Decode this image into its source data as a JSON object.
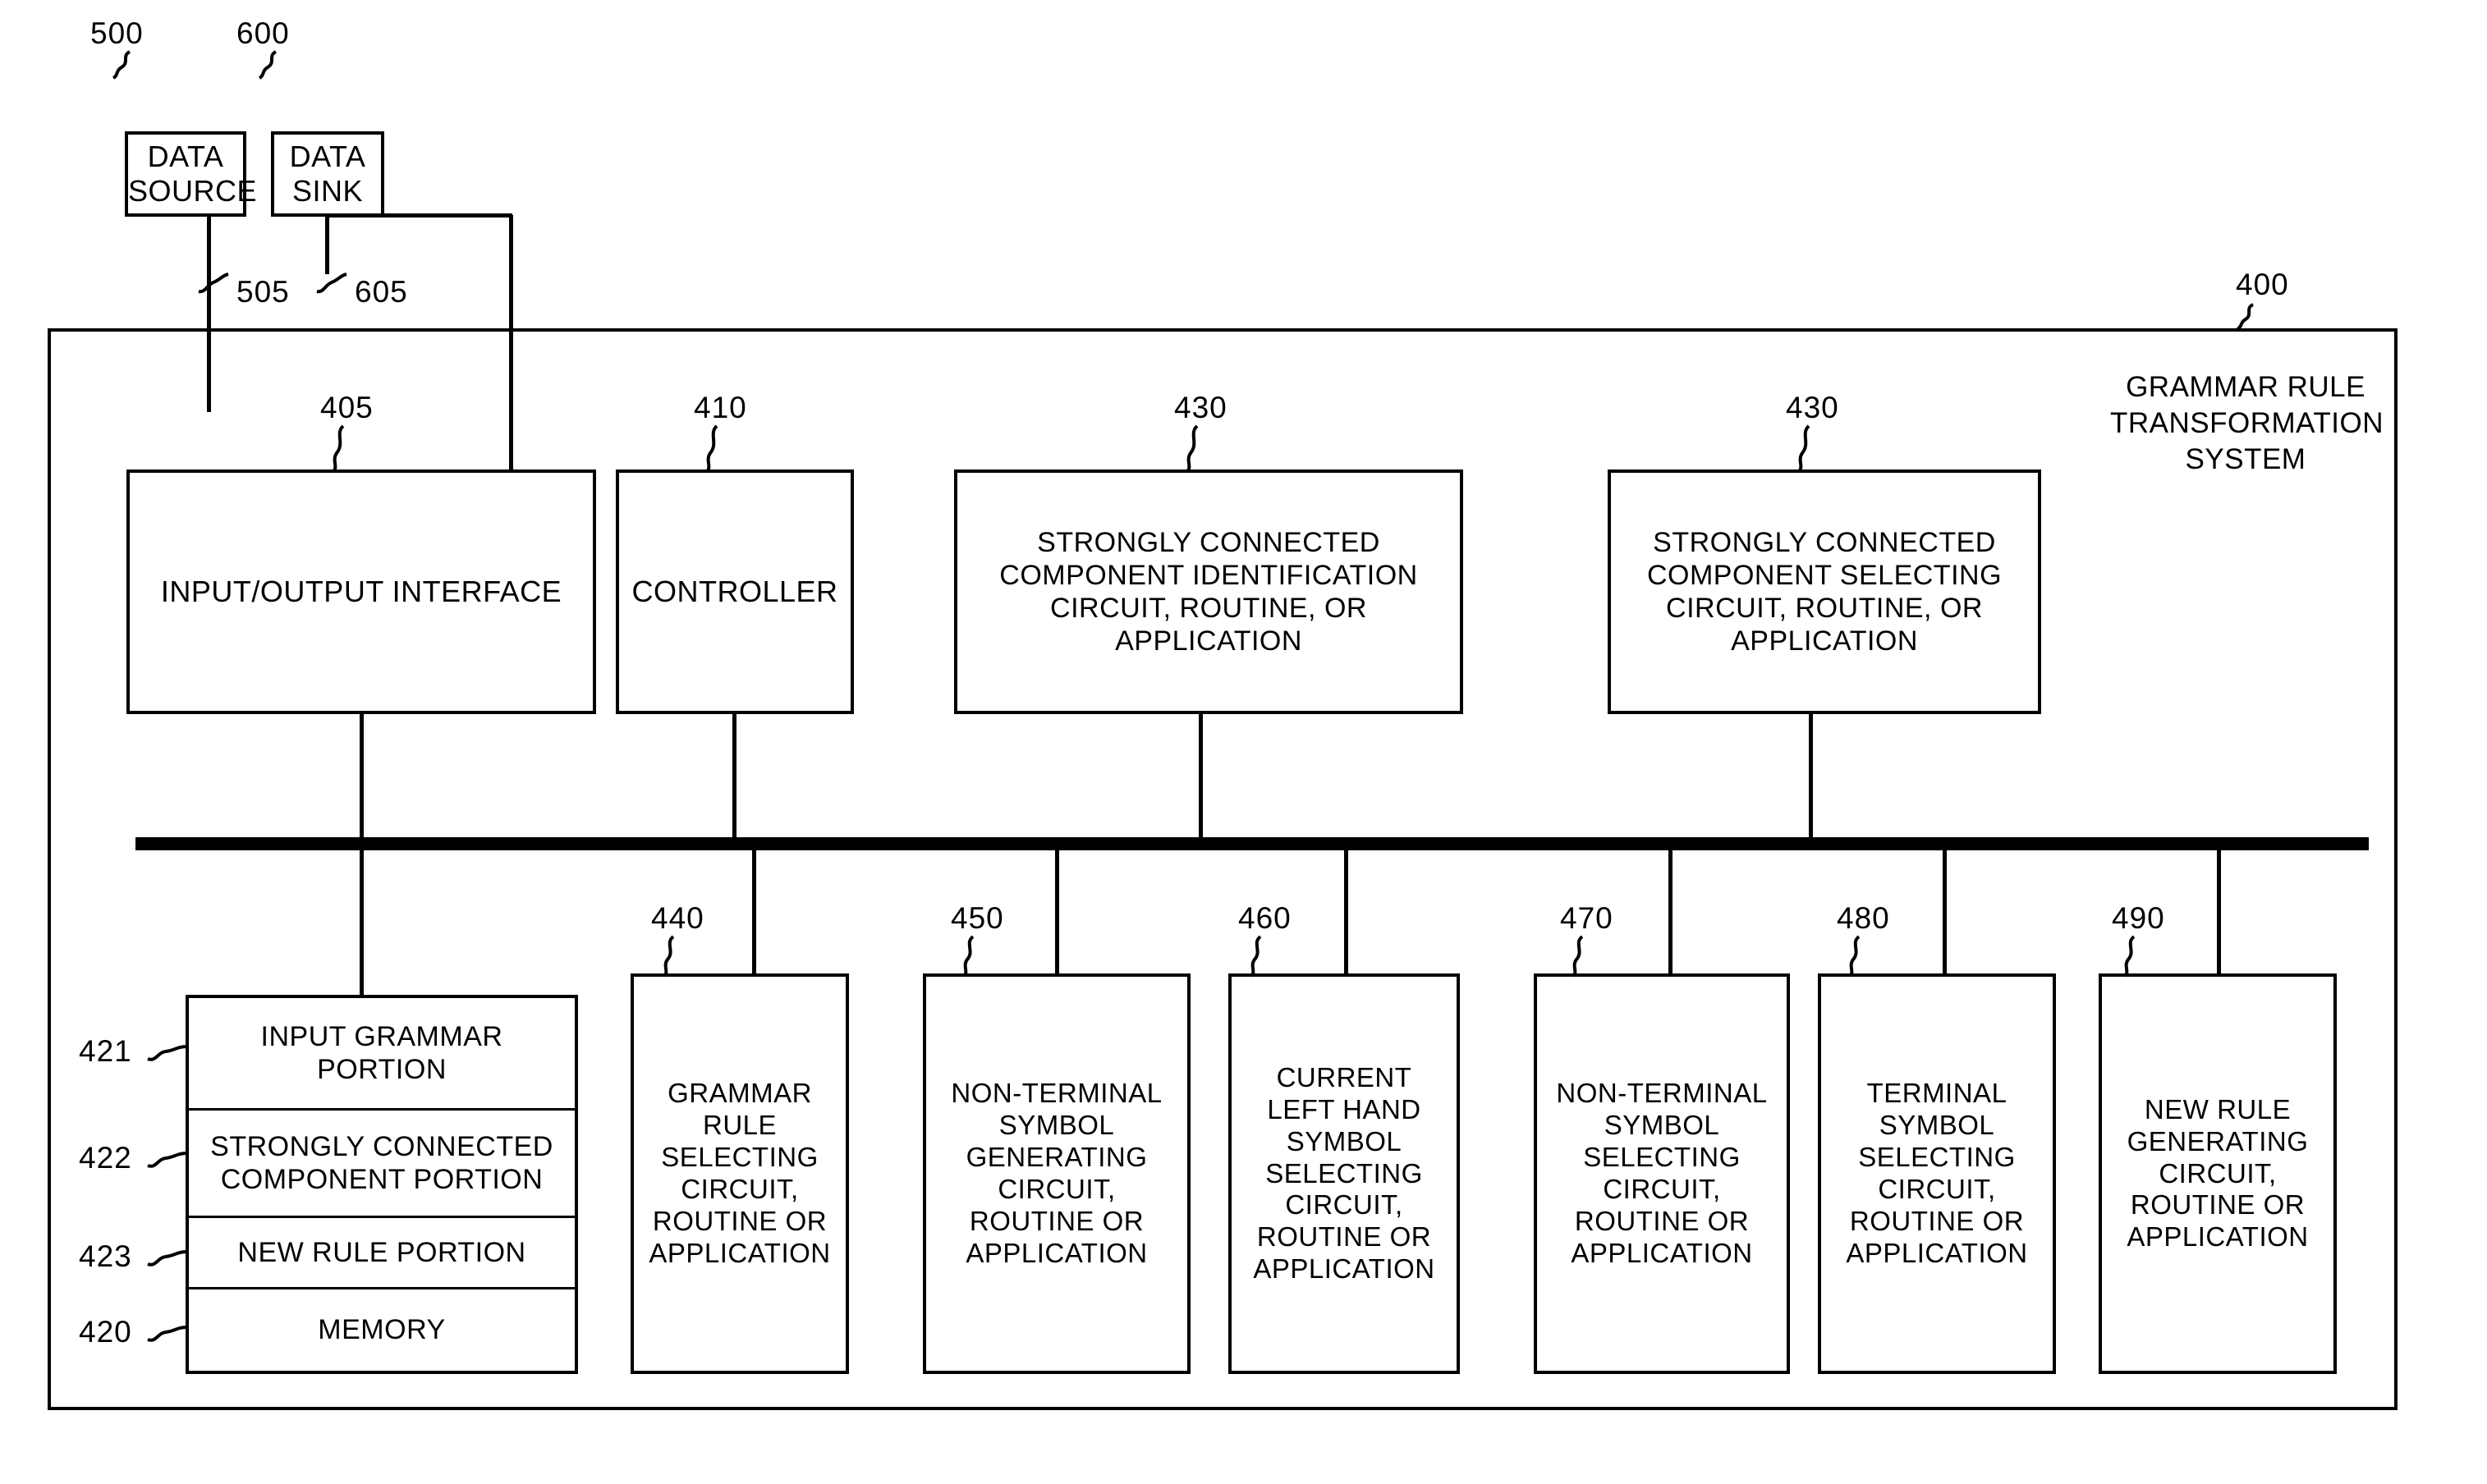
{
  "figure": {
    "type": "patent-block-diagram",
    "system_label": "400",
    "system_title": "GRAMMAR RULE\nTRANSFORMATION\nSYSTEM"
  },
  "external_blocks": [
    {
      "ref": "500",
      "label": "DATA\nSOURCE",
      "link_ref": "505"
    },
    {
      "ref": "600",
      "label": "DATA\nSINK",
      "link_ref": "605"
    }
  ],
  "top_row_blocks": [
    {
      "ref": "405",
      "label": "INPUT/OUTPUT INTERFACE"
    },
    {
      "ref": "410",
      "label": "CONTROLLER"
    },
    {
      "ref": "430",
      "label": "STRONGLY CONNECTED\nCOMPONENT IDENTIFICATION\nCIRCUIT, ROUTINE, OR\nAPPLICATION"
    },
    {
      "ref": "430",
      "label": "STRONGLY CONNECTED\nCOMPONENT SELECTING\nCIRCUIT, ROUTINE, OR\nAPPLICATION"
    }
  ],
  "memory": {
    "ref": "420",
    "label": "MEMORY",
    "portions": [
      {
        "ref": "421",
        "label": "INPUT GRAMMAR\nPORTION"
      },
      {
        "ref": "422",
        "label": "STRONGLY CONNECTED\nCOMPONENT PORTION"
      },
      {
        "ref": "423",
        "label": "NEW RULE PORTION"
      }
    ]
  },
  "bottom_row_blocks": [
    {
      "ref": "440",
      "label": "GRAMMAR\nRULE\nSELECTING\nCIRCUIT,\nROUTINE OR\nAPPLICATION"
    },
    {
      "ref": "450",
      "label": "NON-TERMINAL\nSYMBOL\nGENERATING\nCIRCUIT,\nROUTINE OR\nAPPLICATION"
    },
    {
      "ref": "460",
      "label": "CURRENT\nLEFT HAND\nSYMBOL\nSELECTING\nCIRCUIT,\nROUTINE OR\nAPPLICATION"
    },
    {
      "ref": "470",
      "label": "NON-TERMINAL\nSYMBOL\nSELECTING\nCIRCUIT,\nROUTINE OR\nAPPLICATION"
    },
    {
      "ref": "480",
      "label": "TERMINAL\nSYMBOL\nSELECTING\nCIRCUIT,\nROUTINE OR\nAPPLICATION"
    },
    {
      "ref": "490",
      "label": "NEW RULE\nGENERATING\nCIRCUIT,\nROUTINE OR\nAPPLICATION"
    }
  ],
  "colors": {
    "ink": "#000000",
    "paper": "#ffffff"
  }
}
